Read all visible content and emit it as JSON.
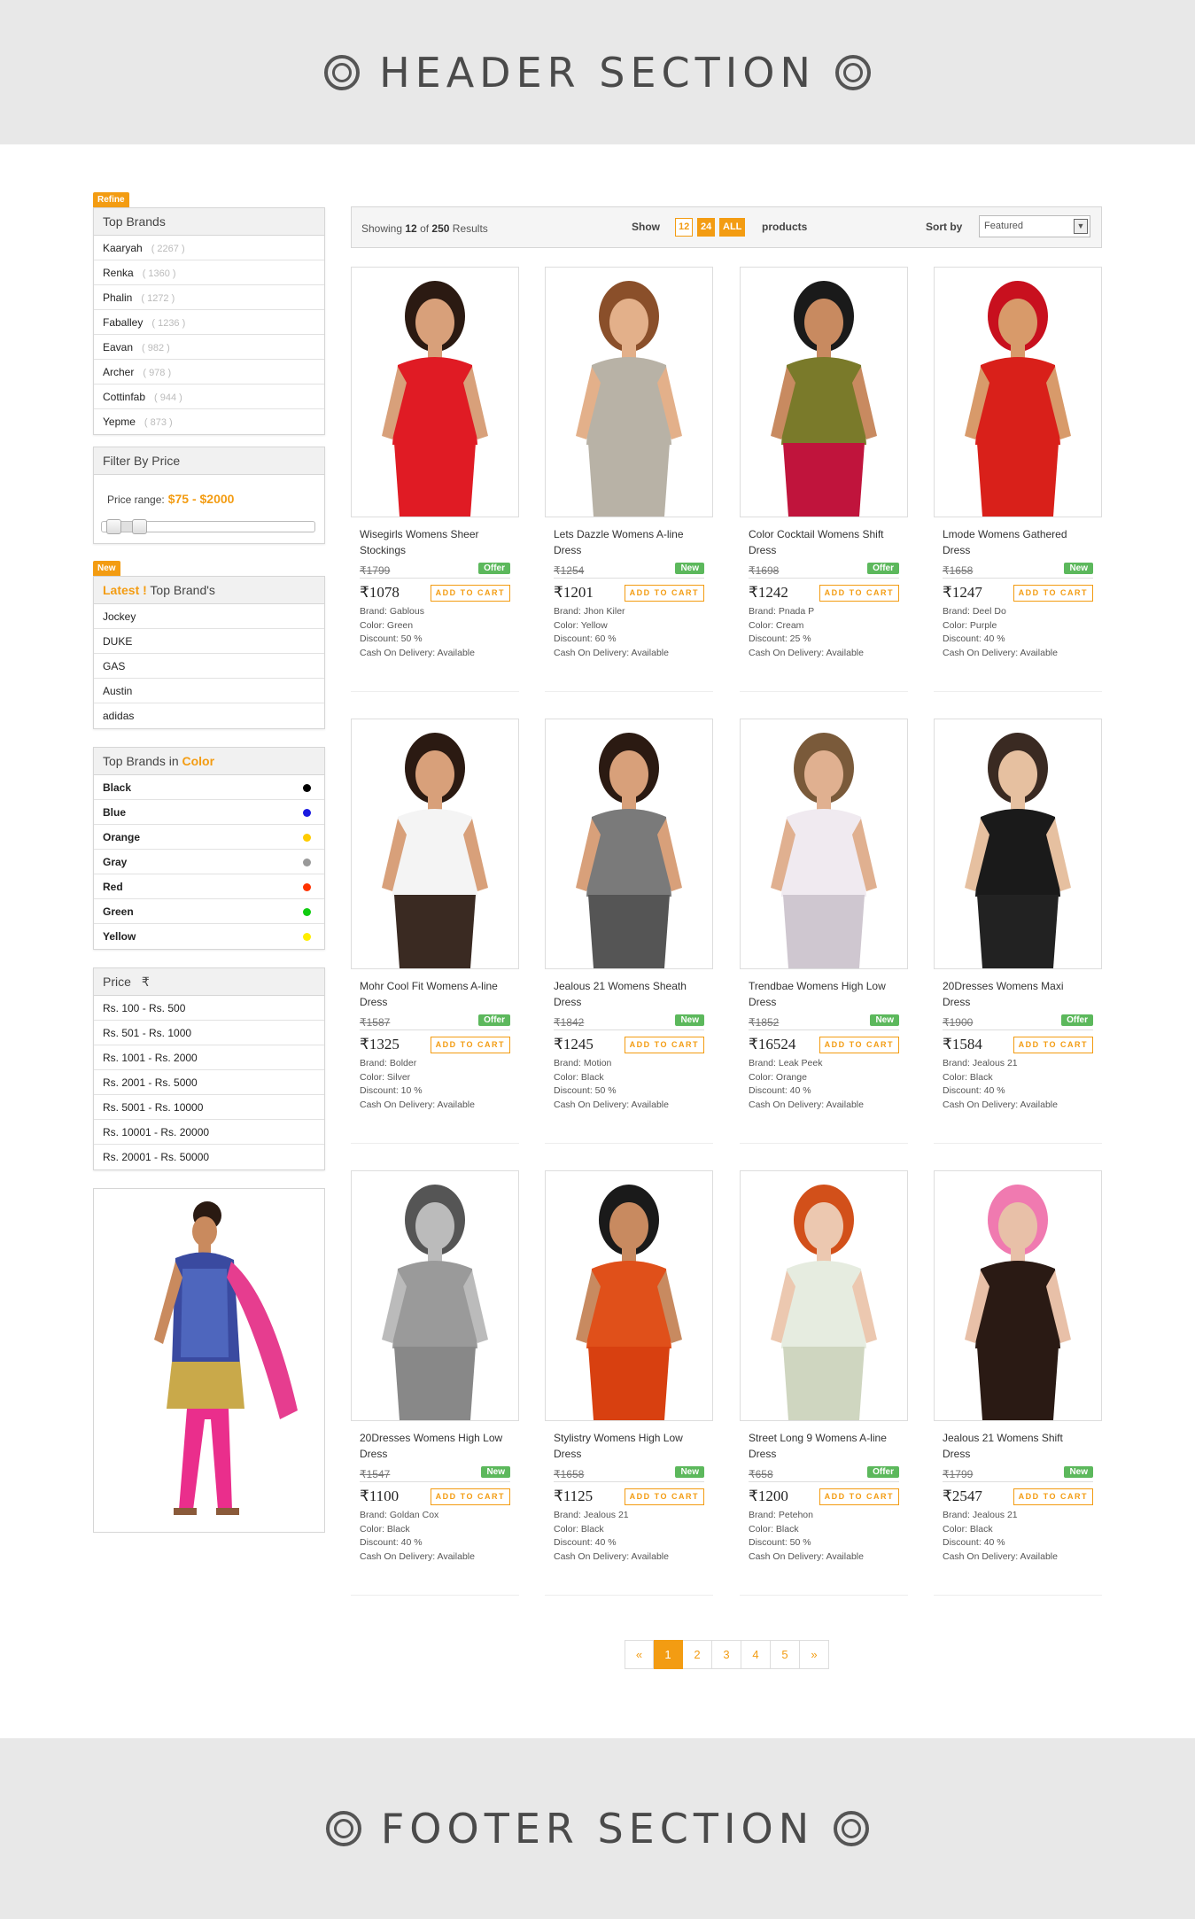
{
  "header": {
    "title": "HEADER SECTION"
  },
  "footer": {
    "title": "FOOTER SECTION"
  },
  "sidebar": {
    "refine_tag": "Refine",
    "top_brands": {
      "title": "Top Brands",
      "items": [
        {
          "name": "Kaaryah",
          "count": "( 2267 )"
        },
        {
          "name": "Renka",
          "count": "( 1360 )"
        },
        {
          "name": "Phalin",
          "count": "( 1272 )"
        },
        {
          "name": "Faballey",
          "count": "( 1236 )"
        },
        {
          "name": "Eavan",
          "count": "( 982 )"
        },
        {
          "name": "Archer",
          "count": "( 978 )"
        },
        {
          "name": "Cottinfab",
          "count": "( 944 )"
        },
        {
          "name": "Yepme",
          "count": "( 873 )"
        }
      ]
    },
    "price_filter": {
      "title": "Filter By Price",
      "label": "Price range:",
      "value": "$75 - $2000",
      "min_fraction": 0.03,
      "max_fraction": 0.14
    },
    "new_tag": "New",
    "latest": {
      "title_highlight": "Latest !",
      "title_rest": " Top Brand's",
      "items": [
        "Jockey",
        "DUKE",
        "GAS",
        "Austin",
        "adidas"
      ]
    },
    "colors": {
      "title_pre": "Top Brands in ",
      "title_highlight": "Color",
      "items": [
        {
          "name": "Black",
          "color": "#000000"
        },
        {
          "name": "Blue",
          "color": "#1a1ae0"
        },
        {
          "name": "Orange",
          "color": "#ffcc00"
        },
        {
          "name": "Gray",
          "color": "#999999"
        },
        {
          "name": "Red",
          "color": "#ff3300"
        },
        {
          "name": "Green",
          "color": "#11cc11"
        },
        {
          "name": "Yellow",
          "color": "#ffee00"
        }
      ]
    },
    "price_list": {
      "title": "Price",
      "currency_symbol": "₹",
      "items": [
        "Rs. 100 - Rs. 500",
        "Rs. 501 - Rs. 1000",
        "Rs. 1001 - Rs. 2000",
        "Rs. 2001 - Rs. 5000",
        "Rs. 5001 - Rs. 10000",
        "Rs. 10001 - Rs. 20000",
        "Rs. 20001 - Rs. 50000"
      ]
    }
  },
  "toolbar": {
    "showing_pre": "Showing ",
    "showing_count": "12",
    "showing_mid": " of ",
    "showing_total": "250",
    "showing_post": " Results",
    "show_label": "Show",
    "show_options": [
      "12",
      "24",
      "ALL"
    ],
    "products_label": "products",
    "sort_label": "Sort by",
    "sort_value": "Featured"
  },
  "products": [
    {
      "name": "Wisegirls Womens Sheer Stockings",
      "old": "₹1799",
      "price": "₹1078",
      "badge": "Offer",
      "brand": "Brand: Gablous",
      "color": "Color: Green",
      "discount": "Discount: 50 %",
      "cod": "Cash On Delivery: Available"
    },
    {
      "name": "Lets Dazzle Womens A-line Dress",
      "old": "₹1254",
      "price": "₹1201",
      "badge": "New",
      "brand": "Brand: Jhon Kiler",
      "color": "Color: Yellow",
      "discount": "Discount: 60 %",
      "cod": "Cash On Delivery: Available"
    },
    {
      "name": "Color Cocktail Womens Shift Dress",
      "old": "₹1698",
      "price": "₹1242",
      "badge": "Offer",
      "brand": "Brand: Pnada P",
      "color": "Color: Cream",
      "discount": "Discount: 25 %",
      "cod": "Cash On Delivery: Available"
    },
    {
      "name": "Lmode Womens Gathered Dress",
      "old": "₹1658",
      "price": "₹1247",
      "badge": "New",
      "brand": "Brand: Deel Do",
      "color": "Color: Purple",
      "discount": "Discount: 40 %",
      "cod": "Cash On Delivery: Available"
    },
    {
      "name": "Mohr Cool Fit Womens A-line Dress",
      "old": "₹1587",
      "price": "₹1325",
      "badge": "Offer",
      "brand": "Brand: Bolder",
      "color": "Color: Silver",
      "discount": "Discount: 10 %",
      "cod": "Cash On Delivery: Available"
    },
    {
      "name": "Jealous 21 Womens Sheath Dress",
      "old": "₹1842",
      "price": "₹1245",
      "badge": "New",
      "brand": "Brand: Motion",
      "color": "Color: Black",
      "discount": "Discount: 50 %",
      "cod": "Cash On Delivery: Available"
    },
    {
      "name": "Trendbae Womens High Low Dress",
      "old": "₹1852",
      "price": "₹16524",
      "badge": "New",
      "brand": "Brand: Leak Peek",
      "color": "Color: Orange",
      "discount": "Discount: 40 %",
      "cod": "Cash On Delivery: Available"
    },
    {
      "name": "20Dresses Womens Maxi Dress",
      "old": "₹1900",
      "price": "₹1584",
      "badge": "Offer",
      "brand": "Brand: Jealous 21",
      "color": "Color: Black",
      "discount": "Discount: 40 %",
      "cod": "Cash On Delivery: Available"
    },
    {
      "name": "20Dresses Womens High Low Dress",
      "old": "₹1547",
      "price": "₹1100",
      "badge": "New",
      "brand": "Brand: Goldan Cox",
      "color": "Color: Black",
      "discount": "Discount: 40 %",
      "cod": "Cash On Delivery: Available"
    },
    {
      "name": "Stylistry Womens High Low Dress",
      "old": "₹1658",
      "price": "₹1125",
      "badge": "New",
      "brand": "Brand: Jealous 21",
      "color": "Color: Black",
      "discount": "Discount: 40 %",
      "cod": "Cash On Delivery: Available"
    },
    {
      "name": "Street Long 9 Womens A-line Dress",
      "old": "₹658",
      "price": "₹1200",
      "badge": "Offer",
      "brand": "Brand: Petehon",
      "color": "Color: Black",
      "discount": "Discount: 50 %",
      "cod": "Cash On Delivery: Available"
    },
    {
      "name": "Jealous 21 Womens Shift Dress",
      "old": "₹1799",
      "price": "₹2547",
      "badge": "New",
      "brand": "Brand: Jealous 21",
      "color": "Color: Black",
      "discount": "Discount: 40 %",
      "cod": "Cash On Delivery: Available"
    }
  ],
  "add_to_cart_label": "ADD TO CART",
  "pagination": [
    "«",
    "1",
    "2",
    "3",
    "4",
    "5",
    "»"
  ],
  "pagination_active": "1",
  "colors": {
    "accent": "#f39c12",
    "badge_green": "#5cb85c"
  }
}
